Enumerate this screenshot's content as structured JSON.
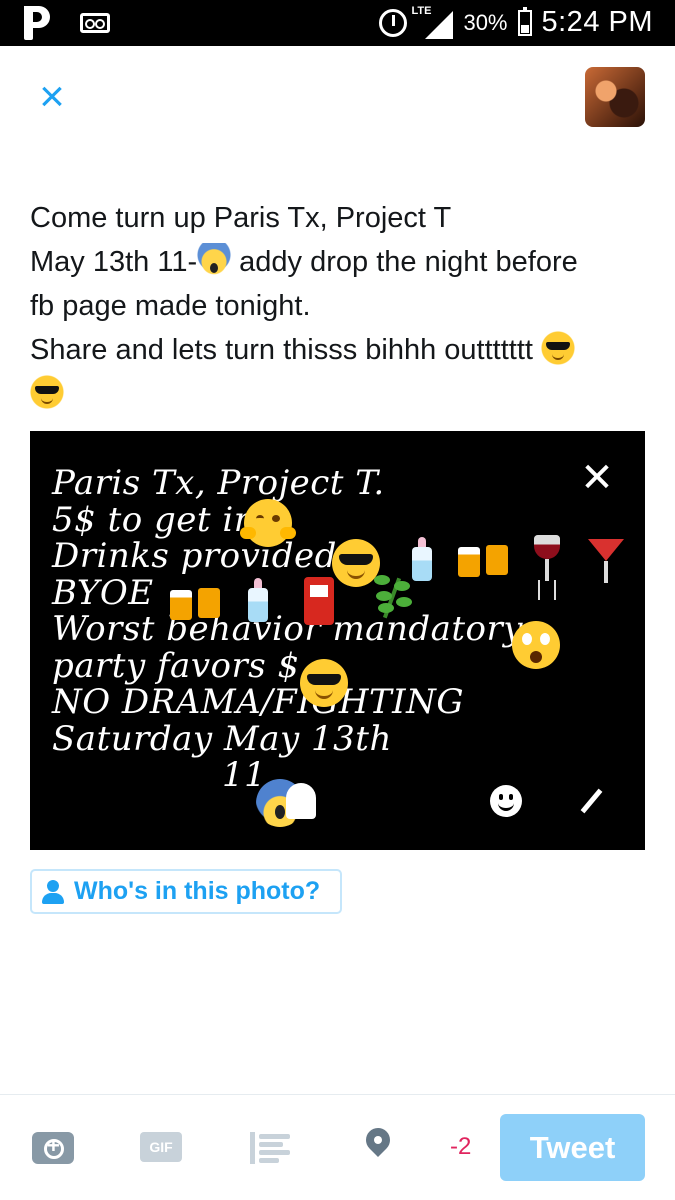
{
  "status_bar": {
    "network": "LTE",
    "battery": "30%",
    "time": "5:24 PM"
  },
  "compose": {
    "tweet_lines": [
      "Come turn up Paris Tx, Project T",
      "May 13th 11-",
      " addy drop the night before",
      "fb page made tonight.",
      "Share and lets turn thisss bihhh outtttttt "
    ],
    "photo_text": [
      "Paris Tx, Project T.",
      "5$ to get in",
      "Drinks provided",
      "BYOE",
      "Worst behavior mandatory",
      "party favors $",
      "NO DRAMA/FIGHTING",
      "Saturday May 13th",
      "11"
    ],
    "tag_label": "Who's in this photo?"
  },
  "toolbar": {
    "gif_label": "GIF",
    "char_count": "-2",
    "tweet_label": "Tweet"
  },
  "icons": {
    "close": "close-icon",
    "camera": "camera-icon",
    "gif": "gif-icon",
    "poll": "poll-icon",
    "location": "location-pin-icon",
    "tag": "person-icon"
  },
  "colors": {
    "accent": "#1da1f2",
    "tweet_button_disabled": "#8ed0f9",
    "over_limit": "#e0245e"
  }
}
